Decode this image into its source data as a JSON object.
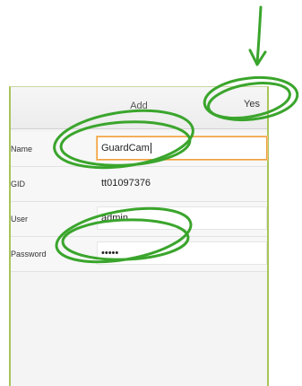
{
  "header": {
    "title": "Add",
    "confirm_label": "Yes"
  },
  "form": {
    "fields": [
      {
        "label": "Name",
        "value": "GuardCam"
      },
      {
        "label": "GID",
        "value": "tt01097376"
      },
      {
        "label": "User",
        "value": "admin"
      },
      {
        "label": "Password",
        "value": "•••••"
      }
    ]
  },
  "colors": {
    "annotation": "#3aa52c",
    "device_border": "#a9c45a",
    "focus_border": "#f0a040"
  }
}
